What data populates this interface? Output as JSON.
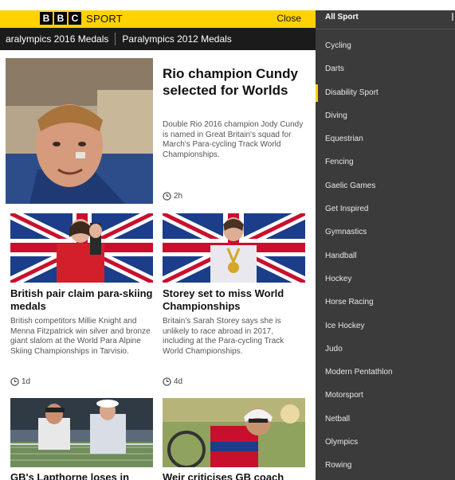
{
  "header": {
    "logo_letters": [
      "B",
      "B",
      "C"
    ],
    "logo_sport": "SPORT",
    "close_label": "Close"
  },
  "subnav": {
    "items": [
      "aralympics 2016 Medals",
      "Paralympics 2012 Medals"
    ]
  },
  "lead": {
    "headline": "Rio champion Cundy selected for Worlds",
    "summary": "Double Rio 2016 champion Jody Cundy is named in Great Britain's squad for March's Para-cycling Track World Championships.",
    "time": "2h"
  },
  "cards": [
    {
      "headline": "British pair claim para-skiing medals",
      "summary": "British competitors Millie Knight and Menna Fitzpatrick win silver and bronze giant slalom at the World Para Alpine Skiing Championships in Tarvisio.",
      "time": "1d"
    },
    {
      "headline": "Storey set to miss World Championships",
      "summary": "Britain's Sarah Storey says she is unlikely to race abroad in 2017, including at the Para-cycling Track World Championships.",
      "time": "4d"
    },
    {
      "headline": "GB's Lapthorne loses in",
      "summary": "",
      "time": ""
    },
    {
      "headline": "Weir criticises GB coach",
      "summary": "",
      "time": ""
    }
  ],
  "sidebar": {
    "title": "All Sport",
    "items": [
      "Cycling",
      "Darts",
      "Disability Sport",
      "Diving",
      "Equestrian",
      "Fencing",
      "Gaelic Games",
      "Get Inspired",
      "Gymnastics",
      "Handball",
      "Hockey",
      "Horse Racing",
      "Ice Hockey",
      "Judo",
      "Modern Pentathlon",
      "Motorsport",
      "Netball",
      "Olympics",
      "Rowing"
    ],
    "active_item": "Disability Sport"
  },
  "colors": {
    "brand_yellow": "#ffd200",
    "subnav_bg": "#1b1b1b",
    "sidebar_bg": "#3b3b3b"
  },
  "icons": {
    "clock": "clock-icon",
    "logo": "bbc-logo"
  }
}
